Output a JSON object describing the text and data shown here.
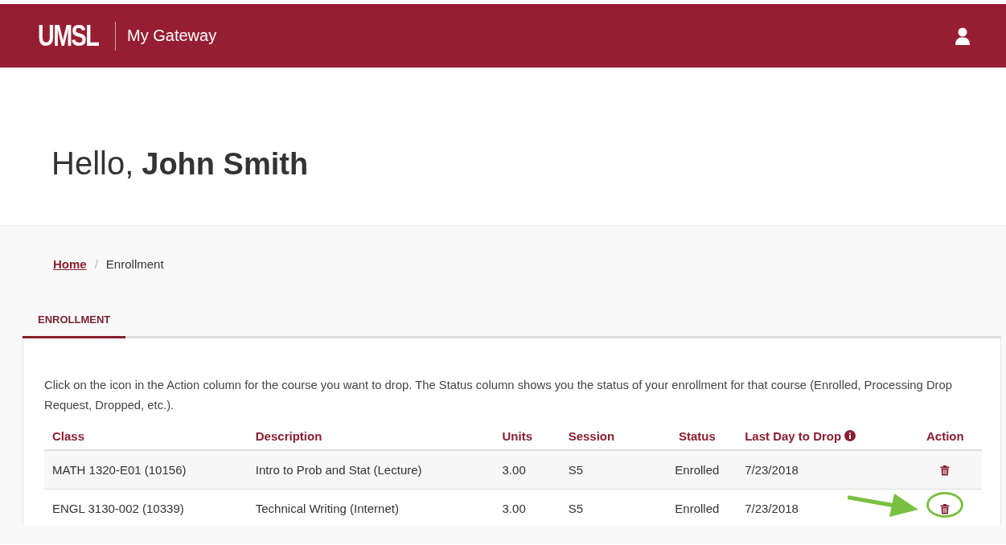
{
  "header": {
    "logo": "UMSL",
    "title": "My Gateway"
  },
  "greeting": {
    "salutation": "Hello,",
    "name": "John Smith"
  },
  "breadcrumb_separator": "/",
  "breadcrumb": [
    {
      "label": "Home",
      "kind": "link"
    },
    {
      "label": "Enrollment",
      "kind": "current"
    }
  ],
  "tabs": [
    {
      "label": "ENROLLMENT",
      "selected": true
    }
  ],
  "instructions": "Click on the icon in the Action column for the course you want to drop. The Status column shows you the status of your enrollment for that course (Enrolled, Processing Drop Request, Dropped, etc.).",
  "table": {
    "columns": [
      {
        "label": "Class",
        "info": false
      },
      {
        "label": "Description",
        "info": false
      },
      {
        "label": "Units",
        "info": false
      },
      {
        "label": "Session",
        "info": false
      },
      {
        "label": "Status",
        "info": false
      },
      {
        "label": "Last Day to Drop",
        "info": true
      },
      {
        "label": "Action",
        "info": false
      }
    ],
    "rows": [
      {
        "cells": [
          "MATH 1320-E01 (10156)",
          "Intro to Prob and Stat (Lecture)",
          "3.00",
          "S5",
          "Enrolled",
          "7/23/2018"
        ],
        "highlighted": false
      },
      {
        "cells": [
          "ENGL 3130-002 (10339)",
          "Technical Writing (Internet)",
          "3.00",
          "S5",
          "Enrolled",
          "7/23/2018"
        ],
        "highlighted": true
      }
    ]
  }
}
